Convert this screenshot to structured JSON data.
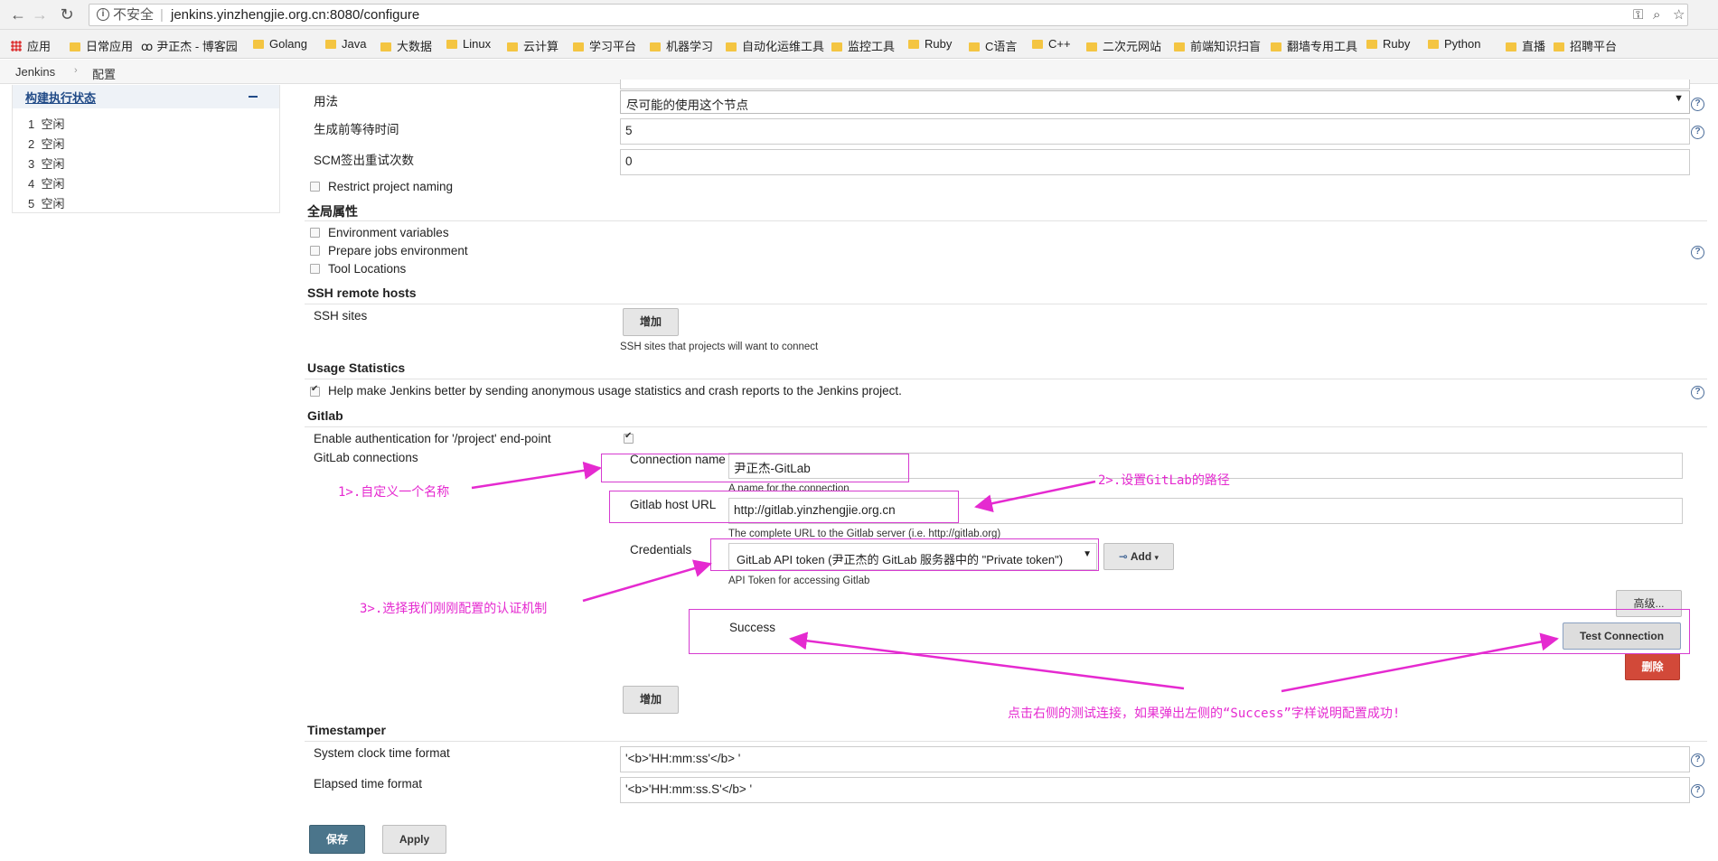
{
  "browser": {
    "security": "不安全",
    "url": "jenkins.yinzhengjie.org.cn:8080/configure"
  },
  "bookmarks": [
    "应用",
    "日常应用",
    "尹正杰 - 博客园",
    "Golang",
    "Java",
    "大数据",
    "Linux",
    "云计算",
    "学习平台",
    "机器学习",
    "自动化运维工具",
    "监控工具",
    "Ruby",
    "C语言",
    "C++",
    "二次元网站",
    "前端知识扫盲",
    "翻墙专用工具",
    "Ruby",
    "Python",
    "直播",
    "招聘平台"
  ],
  "breadcrumb": {
    "root": "Jenkins",
    "separator": "›",
    "page": "配置"
  },
  "executor_panel": {
    "title": "构建执行状态",
    "executors": [
      {
        "num": "1",
        "status": "空闲"
      },
      {
        "num": "2",
        "status": "空闲"
      },
      {
        "num": "3",
        "status": "空闲"
      },
      {
        "num": "4",
        "status": "空闲"
      },
      {
        "num": "5",
        "status": "空闲"
      }
    ]
  },
  "form": {
    "usage_label": "用法",
    "usage_value": "尽可能的使用这个节点",
    "quiet_period_label": "生成前等待时间",
    "quiet_period_value": "5",
    "scm_retry_label": "SCM签出重试次数",
    "scm_retry_value": "0",
    "restrict_naming": "Restrict project naming",
    "global_props_title": "全局属性",
    "env_vars": "Environment variables",
    "prepare_jobs": "Prepare jobs environment",
    "tool_locations": "Tool Locations",
    "ssh_title": "SSH remote hosts",
    "ssh_sites_label": "SSH sites",
    "ssh_add_button": "增加",
    "ssh_sites_desc": "SSH sites that projects will want to connect",
    "usage_stats_title": "Usage Statistics",
    "usage_stats_checkbox": "Help make Jenkins better by sending anonymous usage statistics and crash reports to the Jenkins project.",
    "gitlab_title": "Gitlab",
    "enable_auth_label": "Enable authentication for '/project' end-point",
    "gitlab_connections_label": "GitLab connections",
    "connection_name_label": "Connection name",
    "connection_name_value": "尹正杰-GitLab",
    "connection_name_desc": "A name for the connection",
    "host_url_label": "Gitlab host URL",
    "host_url_value": "http://gitlab.yinzhengjie.org.cn",
    "host_url_desc": "The complete URL to the Gitlab server (i.e. http://gitlab.org)",
    "credentials_label": "Credentials",
    "credentials_value": "GitLab API token (尹正杰的 GitLab 服务器中的 \"Private token\")",
    "credentials_add": "Add",
    "credentials_desc": "API Token for accessing Gitlab",
    "advanced_button": "高级...",
    "success_text": "Success",
    "test_connection_button": "Test Connection",
    "delete_button": "删除",
    "gitlab_add_button": "增加",
    "timestamper_title": "Timestamper",
    "system_clock_label": "System clock time format",
    "system_clock_value": "'<b>'HH:mm:ss'</b> '",
    "elapsed_label": "Elapsed time format",
    "elapsed_value": "'<b>'HH:mm:ss.S'</b> '",
    "save_button": "保存",
    "apply_button": "Apply"
  },
  "annotations": {
    "step1": "1>.自定义一个名称",
    "step2": "2>.设置GitLab的路径",
    "step3": "3>.选择我们刚刚配置的认证机制",
    "step4": "点击右侧的测试连接，如果弹出左侧的“Success”字样说明配置成功!"
  },
  "colors": {
    "accent": "#e52ad0",
    "save": "#4b758b",
    "delete": "#d24939"
  }
}
